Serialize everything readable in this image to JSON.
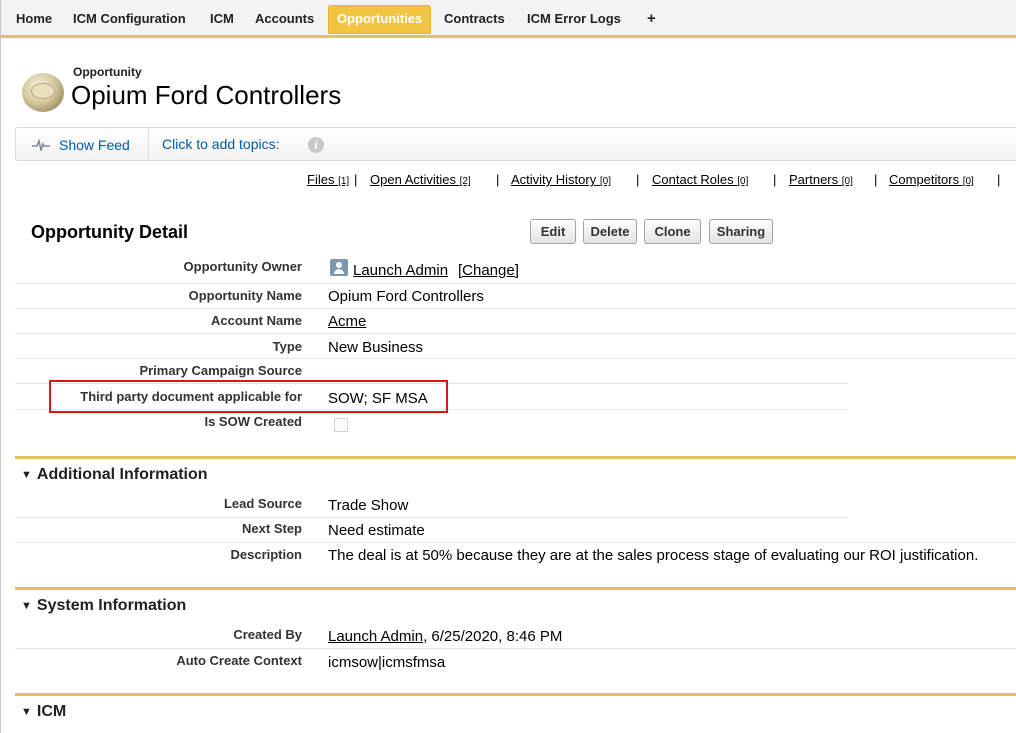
{
  "tabs": [
    {
      "label": "Home"
    },
    {
      "label": "ICM Configuration"
    },
    {
      "label": "ICM"
    },
    {
      "label": "Accounts"
    },
    {
      "label": "Opportunities"
    },
    {
      "label": "Contracts"
    },
    {
      "label": "ICM Error Logs"
    },
    {
      "label": "+"
    }
  ],
  "header": {
    "object_type": "Opportunity",
    "title": "Opium Ford Controllers"
  },
  "feed": {
    "show_feed": "Show Feed",
    "add_topics": "Click to add topics:",
    "info_icon": "i"
  },
  "related_links": [
    {
      "label": "Files",
      "count": "[1]"
    },
    {
      "label": "Open Activities",
      "count": "[2]"
    },
    {
      "label": "Activity History",
      "count": "[0]"
    },
    {
      "label": "Contact Roles",
      "count": "[0]"
    },
    {
      "label": "Partners",
      "count": "[0]"
    },
    {
      "label": "Competitors",
      "count": "[0]"
    }
  ],
  "detail": {
    "title": "Opportunity Detail",
    "buttons": {
      "edit": "Edit",
      "delete": "Delete",
      "clone": "Clone",
      "sharing": "Sharing"
    },
    "fields": {
      "owner_label": "Opportunity Owner",
      "owner_value": "Launch Admin",
      "owner_change": "[Change]",
      "name_label": "Opportunity Name",
      "name_value": "Opium Ford Controllers",
      "account_label": "Account Name",
      "account_value": "Acme",
      "type_label": "Type",
      "type_value": "New Business",
      "campaign_label": "Primary Campaign Source",
      "campaign_value": "",
      "third_party_label": "Third party document applicable for",
      "third_party_value": "SOW; SF MSA",
      "sow_label": "Is SOW Created",
      "sow_checked": false
    }
  },
  "additional": {
    "title": "Additional Information",
    "lead_source_label": "Lead Source",
    "lead_source_value": "Trade Show",
    "next_step_label": "Next Step",
    "next_step_value": "Need estimate",
    "description_label": "Description",
    "description_value": "The deal is at 50% because they are at the sales process stage of evaluating our ROI justification."
  },
  "system": {
    "title": "System Information",
    "created_by_label": "Created By",
    "created_by_user": "Launch Admin",
    "created_by_date": ", 6/25/2020, 8:46 PM",
    "auto_context_label": "Auto Create Context",
    "auto_context_value": "icmsow|icmsfmsa"
  },
  "icm": {
    "title": "ICM"
  },
  "colors": {
    "accent": "#e3c063",
    "active_tab": "#f1c442",
    "link": "#015ba7",
    "highlight_box": "#e0141b"
  }
}
